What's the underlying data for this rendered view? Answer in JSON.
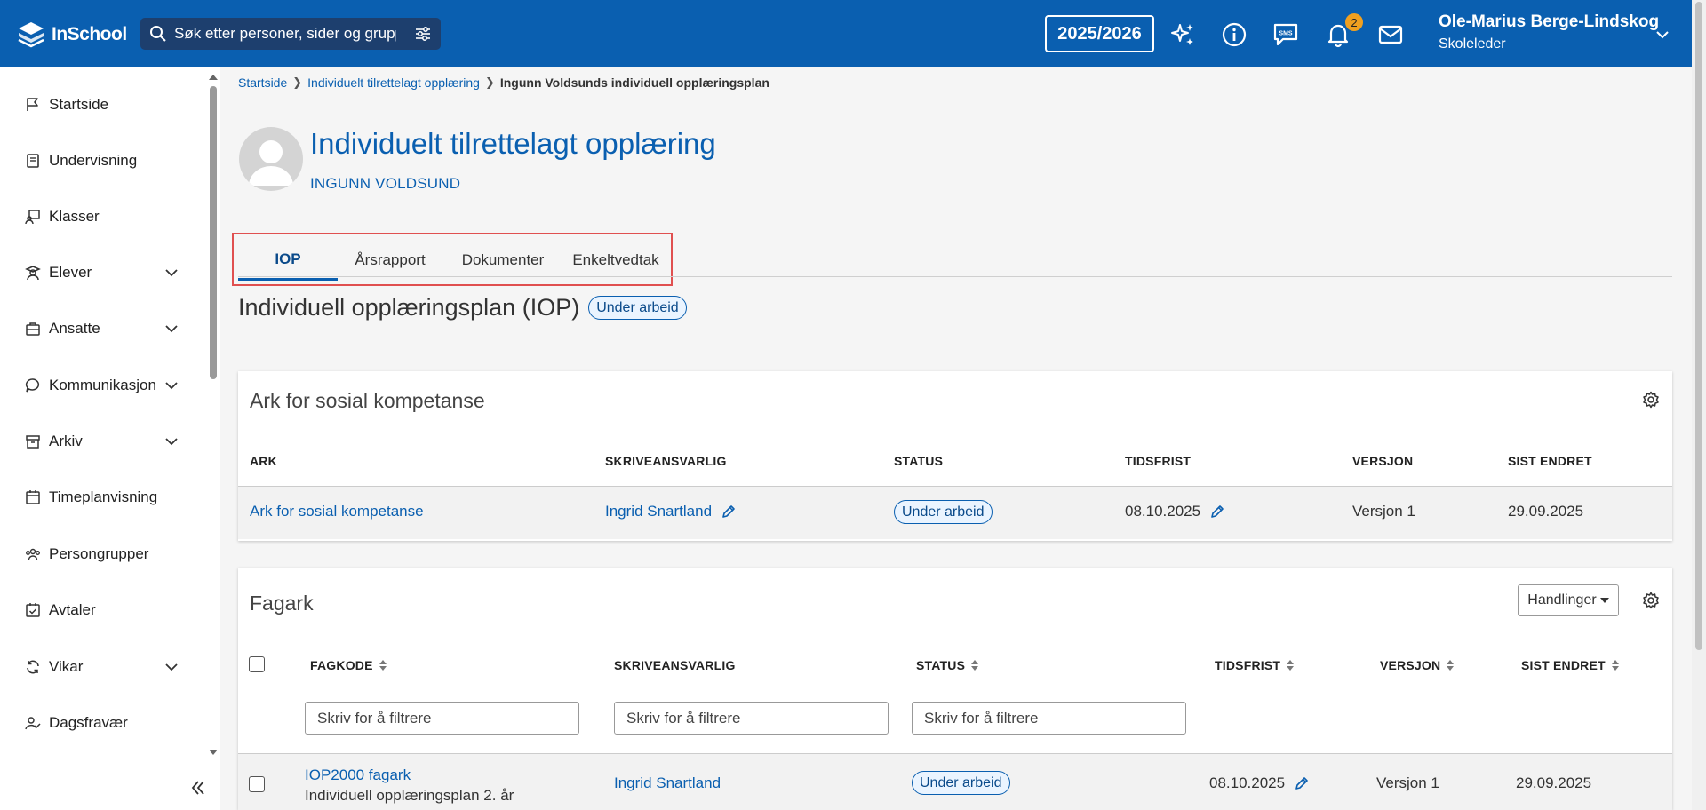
{
  "app": {
    "name": "InSchool"
  },
  "header": {
    "search_placeholder": "Søk etter personer, sider og grupper",
    "year": "2025/2026",
    "notification_count": "2",
    "user_name": "Ole-Marius Berge-Lindskog",
    "user_role": "Skoleleder"
  },
  "sidebar": {
    "items": [
      {
        "label": "Startside",
        "icon": "flag-icon"
      },
      {
        "label": "Undervisning",
        "icon": "book-icon"
      },
      {
        "label": "Klasser",
        "icon": "classroom-icon"
      },
      {
        "label": "Elever",
        "icon": "student-icon"
      },
      {
        "label": "Ansatte",
        "icon": "briefcase-icon"
      },
      {
        "label": "Kommunikasjon",
        "icon": "chat-icon"
      },
      {
        "label": "Arkiv",
        "icon": "archive-icon"
      },
      {
        "label": "Timeplanvisning",
        "icon": "calendar-icon"
      },
      {
        "label": "Persongrupper",
        "icon": "people-icon"
      },
      {
        "label": "Avtaler",
        "icon": "calendar-check-icon"
      },
      {
        "label": "Vikar",
        "icon": "refresh-icon"
      },
      {
        "label": "Dagsfravær",
        "icon": "person-check-icon"
      }
    ]
  },
  "breadcrumb": {
    "home": "Startside",
    "parent": "Individuelt tilrettelagt opplæring",
    "current": "Ingunn Voldsunds individuell opplæringsplan"
  },
  "page": {
    "title": "Individuelt tilrettelagt opplæring",
    "subtitle": "INGUNN VOLDSUND"
  },
  "tabs": [
    "IOP",
    "Årsrapport",
    "Dokumenter",
    "Enkeltvedtak"
  ],
  "iop": {
    "title": "Individuell opplæringsplan (IOP)",
    "status": "Under arbeid"
  },
  "social_card": {
    "title": "Ark for sosial kompetanse",
    "headers": {
      "ark": "ARK",
      "writer": "SKRIVEANSVARLIG",
      "status": "STATUS",
      "deadline": "TIDSFRIST",
      "version": "VERSJON",
      "last_changed": "SIST ENDRET"
    },
    "row": {
      "ark": "Ark for sosial kompetanse",
      "writer": "Ingrid Snartland",
      "status": "Under arbeid",
      "deadline": "08.10.2025",
      "version": "Versjon 1",
      "last_changed": "29.09.2025"
    }
  },
  "subject_card": {
    "title": "Fagark",
    "actions_label": "Handlinger",
    "headers": {
      "code": "FAGKODE",
      "writer": "SKRIVEANSVARLIG",
      "status": "STATUS",
      "deadline": "TIDSFRIST",
      "version": "VERSJON",
      "last_changed": "SIST ENDRET"
    },
    "filter_placeholder": "Skriv for å filtrere",
    "row": {
      "code": "IOP2000 fagark",
      "code_desc": "Individuell opplæringsplan 2. år",
      "writer": "Ingrid Snartland",
      "status": "Under arbeid",
      "deadline": "08.10.2025",
      "version": "Versjon 1",
      "last_changed": "29.09.2025"
    }
  },
  "colors": {
    "brand": "#0a5fb0",
    "highlight_frame": "#e05050",
    "badge": "#f0a020"
  }
}
